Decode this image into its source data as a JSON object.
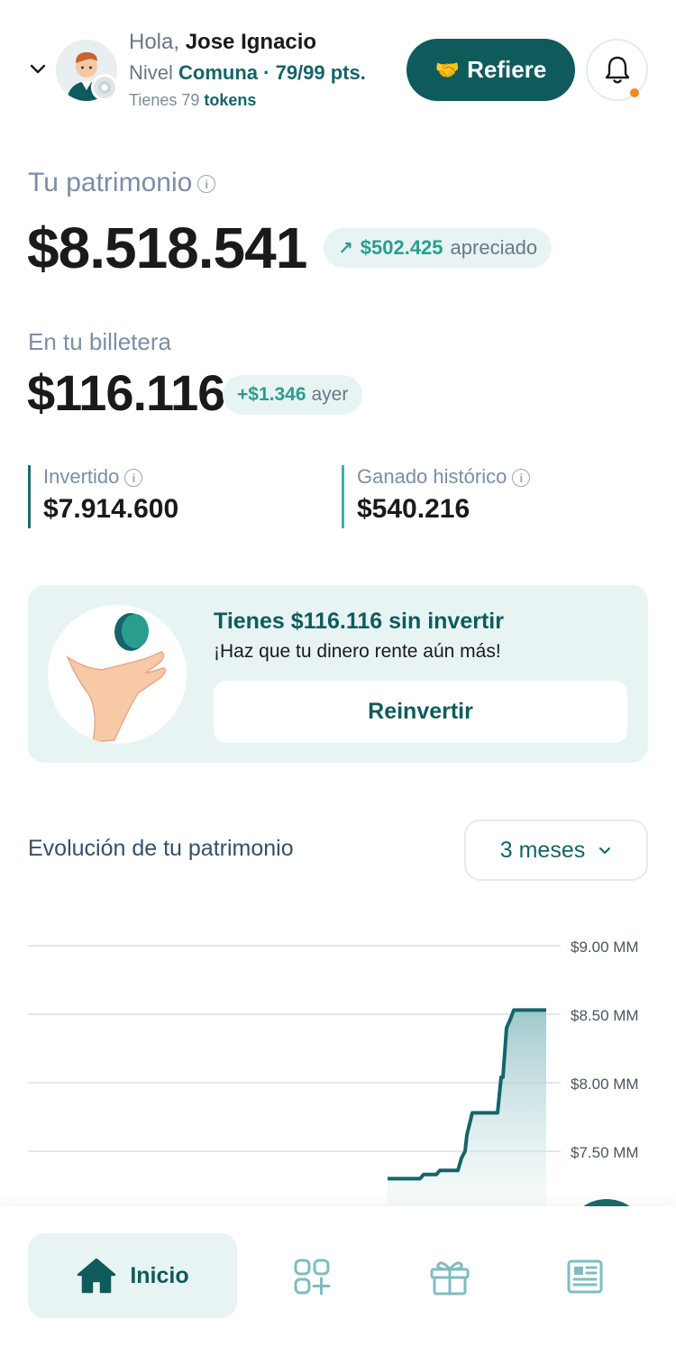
{
  "header": {
    "greeting_prefix": "Hola,",
    "user_name": "Jose Ignacio",
    "level_prefix": "Nivel",
    "level_value": "Comuna · 79/99 pts.",
    "tokens_prefix": "Tienes 79",
    "tokens_word": "tokens",
    "refer_label": "Refiere",
    "refer_icon": "🤝",
    "colors": {
      "brand": "#0f5b5b",
      "accent": "#2a9d8f",
      "notification_dot": "#f08a24"
    }
  },
  "patrimonio": {
    "label": "Tu patrimonio",
    "value": "$8.518.541",
    "appreciated_amount": "$502.425",
    "appreciated_word": "apreciado"
  },
  "billetera": {
    "label": "En tu billetera",
    "value": "$116.116",
    "change_amount": "+$1.346",
    "change_word": "ayer"
  },
  "stats": {
    "invertido_label": "Invertido",
    "invertido_value": "$7.914.600",
    "ganado_label": "Ganado histórico",
    "ganado_value": "$540.216"
  },
  "reinvest_card": {
    "title": "Tienes $116.116 sin invertir",
    "subtitle": "¡Haz que tu dinero rente aún más!",
    "button_label": "Reinvertir"
  },
  "chart_section": {
    "title": "Evolución de tu patrimonio",
    "range_selected": "3 meses"
  },
  "chart_data": {
    "type": "area",
    "title": "Evolución de tu patrimonio",
    "xlabel": "",
    "ylabel": "",
    "yticks": [
      "$9.00 MM",
      "$8.50 MM",
      "$8.00 MM",
      "$7.50 MM"
    ],
    "ylim_visible": [
      7.3,
      9.0
    ],
    "grid": true,
    "series": [
      {
        "values_mm": [
          7.3,
          7.3,
          7.33,
          7.33,
          7.36,
          7.36,
          7.45,
          7.5,
          7.62,
          7.78,
          7.78,
          8.04,
          8.04,
          8.4,
          8.46,
          8.53,
          8.53
        ]
      }
    ],
    "note_visible_portion": "chart is cropped at bottom by navigation bar"
  },
  "nav": {
    "home_label": "Inicio",
    "items": [
      "home-icon",
      "products-icon",
      "gift-icon",
      "news-icon"
    ]
  }
}
